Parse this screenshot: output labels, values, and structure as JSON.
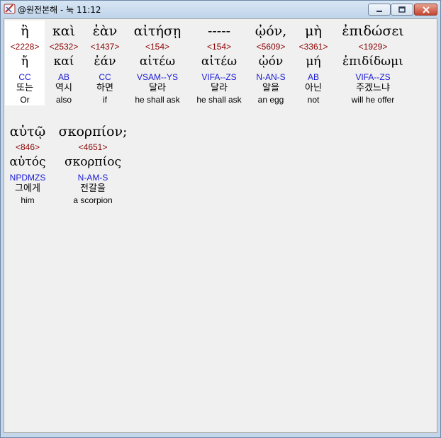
{
  "window": {
    "title": "@원전본해 - 눅 11:12",
    "icon": "app-book-icon",
    "controls": {
      "minimize": "minimize-icon",
      "maximize": "maximize-icon",
      "close": "close-icon"
    }
  },
  "colors": {
    "strong_number": "#8b0000",
    "parsing": "#1a1ad6",
    "text": "#000000",
    "panel_bg": "#f0f0f0",
    "selected_bg": "#ffffff"
  },
  "rows": [
    {
      "words": [
        {
          "greek": "ἢ",
          "strong": "<2228>",
          "lemma": "ἤ",
          "parse": "CC",
          "korean": "또는",
          "english": "Or"
        },
        {
          "greek": "καὶ",
          "strong": "<2532>",
          "lemma": "καί",
          "parse": "AB",
          "korean": "역시",
          "english": "also"
        },
        {
          "greek": "ἐὰν",
          "strong": "<1437>",
          "lemma": "ἐάν",
          "parse": "CC",
          "korean": "하면",
          "english": "if"
        },
        {
          "greek": "αἰτήσῃ",
          "strong": "<154>",
          "lemma": "αἰτέω",
          "parse": "VSAM--YS",
          "korean": "달라",
          "english": "he shall ask"
        },
        {
          "greek": "-----",
          "strong": "<154>",
          "lemma": "αἰτέω",
          "parse": "VIFA--ZS",
          "korean": "달라",
          "english": "he shall ask"
        },
        {
          "greek": "ᾠόν,",
          "strong": "<5609>",
          "lemma": "ᾠόν",
          "parse": "N-AN-S",
          "korean": "알을",
          "english": "an egg"
        },
        {
          "greek": "μὴ",
          "strong": "<3361>",
          "lemma": "μή",
          "parse": "AB",
          "korean": "아닌",
          "english": "not"
        },
        {
          "greek": "ἐπιδώσει",
          "strong": "<1929>",
          "lemma": "ἐπιδίδωμι",
          "parse": "VIFA--ZS",
          "korean": "주겠느냐",
          "english": "will he offer"
        }
      ]
    },
    {
      "words": [
        {
          "greek": "αὐτῷ",
          "strong": "<846>",
          "lemma": "αὐτός",
          "parse": "NPDMZS",
          "korean": "그에게",
          "english": "him"
        },
        {
          "greek": "σκορπίον;",
          "strong": "<4651>",
          "lemma": "σκορπίος",
          "parse": "N-AM-S",
          "korean": "전갈을",
          "english": "a scorpion"
        }
      ]
    }
  ]
}
